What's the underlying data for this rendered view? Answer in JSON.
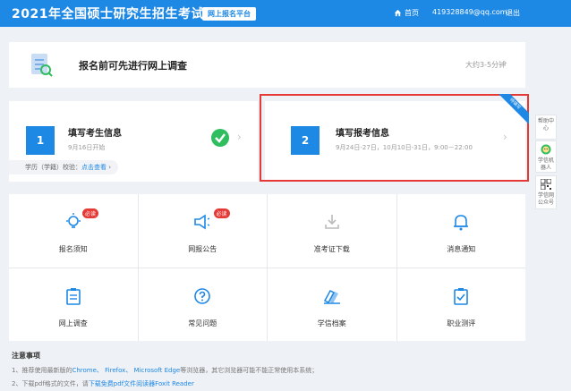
{
  "header": {
    "title": "2021年全国硕士研究生招生考试",
    "badge": "网上报名平台",
    "home": "首页",
    "email": "419328849@qq.com",
    "logout": "退出"
  },
  "survey": {
    "text": "报名前可先进行网上调查",
    "time": "大约3-5分钟"
  },
  "step1": {
    "number": "1",
    "title": "填写考生信息",
    "subtitle": "9月16日开始",
    "verify_label": "学历（学籍）校验：",
    "verify_link": "点击查看"
  },
  "step2": {
    "number": "2",
    "title": "填写报考信息",
    "subtitle": "9月24日-27日，10月10日-31日，9:00－22:00",
    "ribbon": "待填写"
  },
  "grid": {
    "items": [
      {
        "label": "报名须知",
        "badge": "必读"
      },
      {
        "label": "网报公告",
        "badge": "必读"
      },
      {
        "label": "准考证下载"
      },
      {
        "label": "消息通知"
      },
      {
        "label": "网上调查"
      },
      {
        "label": "常见问题"
      },
      {
        "label": "学信档案"
      },
      {
        "label": "职业测评"
      }
    ]
  },
  "sidebar": {
    "help": "帮助中心",
    "robot": "学信机器人",
    "wechat": "学信网公众号"
  },
  "notice": {
    "title": "注意事项",
    "line1_prefix": "1、推荐使用最新版的",
    "browsers": "Chrome、 Firefox、 Microsoft Edge",
    "line1_suffix": "等浏览器，其它浏览器可能不能正常使用本系统；",
    "line2_prefix": "2、下载pdf格式的文件，请",
    "line2_link": "下载免费pdf文件阅读器Foxit Reader"
  },
  "colors": {
    "primary": "#1e88e5",
    "success": "#2ebd5f",
    "danger": "#e53935",
    "background": "#eef1f5"
  }
}
